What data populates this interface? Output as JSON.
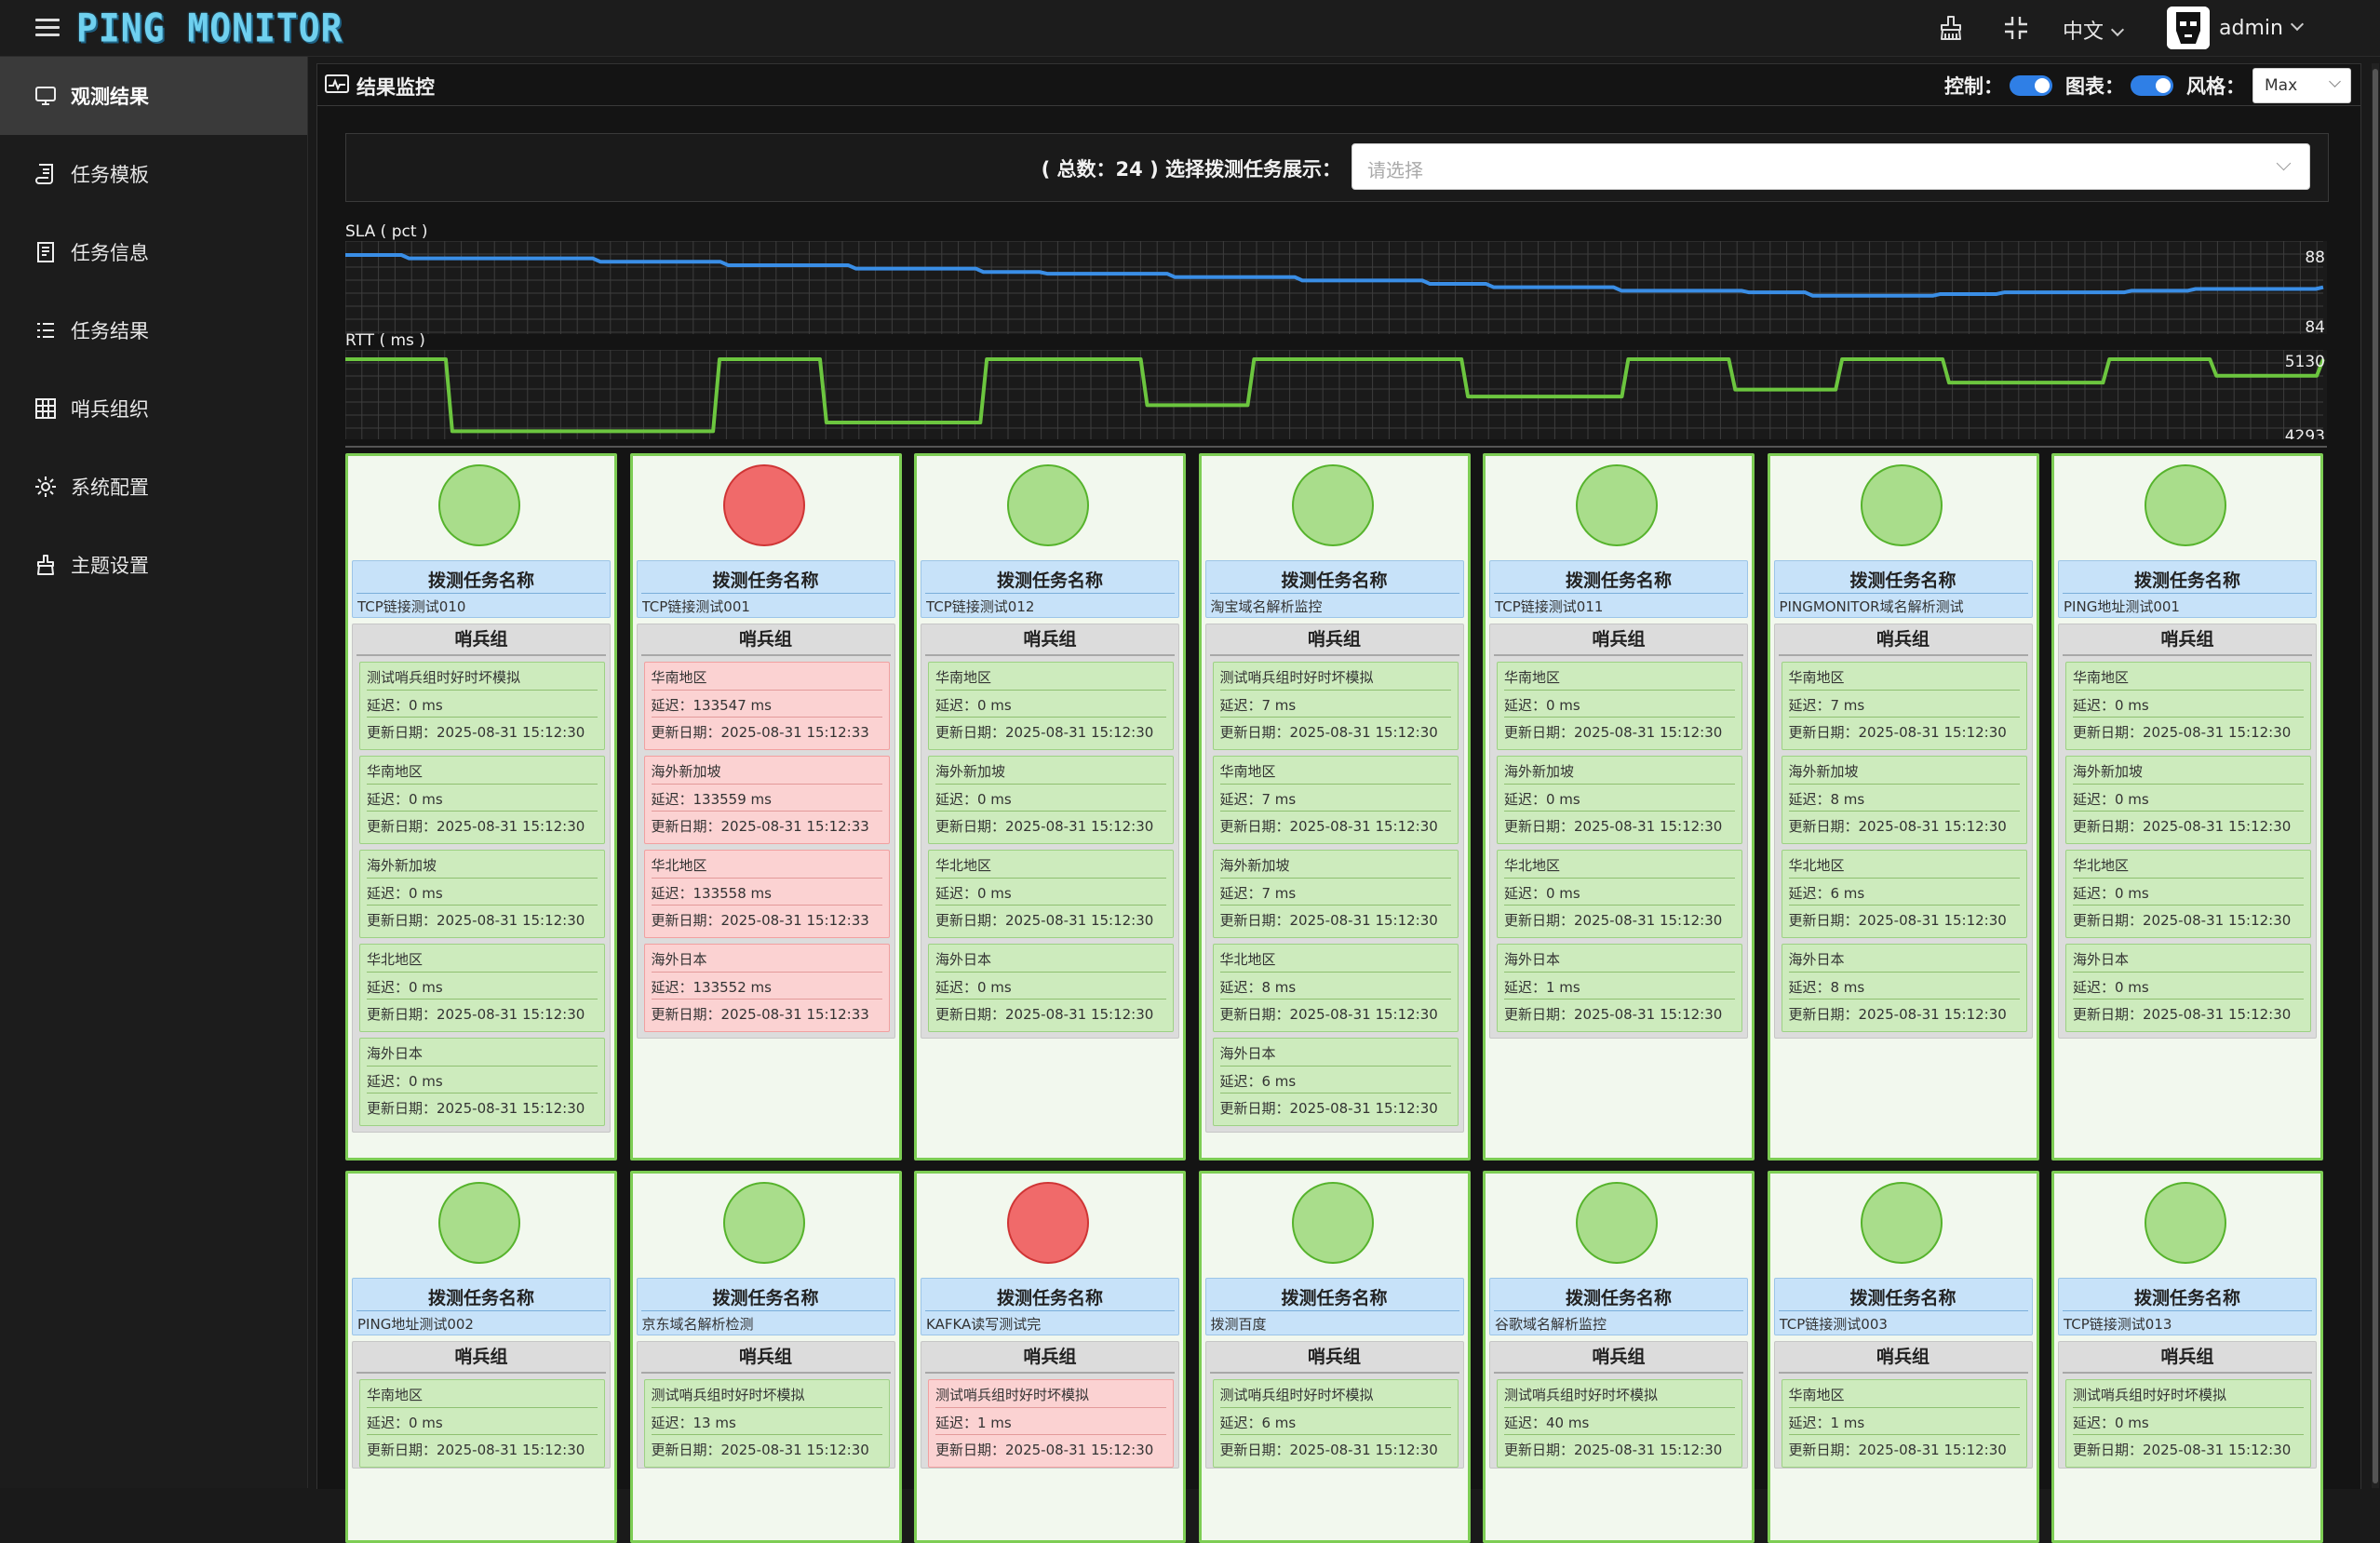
{
  "header": {
    "logo": "PING MONITOR",
    "language": "中文",
    "username": "admin"
  },
  "sidebar": {
    "items": [
      {
        "label": "观测结果",
        "icon": "monitor-icon",
        "active": true
      },
      {
        "label": "任务模板",
        "icon": "scroll-icon",
        "active": false
      },
      {
        "label": "任务信息",
        "icon": "document-icon",
        "active": false
      },
      {
        "label": "任务结果",
        "icon": "list-icon",
        "active": false
      },
      {
        "label": "哨兵组织",
        "icon": "grid-icon",
        "active": false
      },
      {
        "label": "系统配置",
        "icon": "gear-icon",
        "active": false
      },
      {
        "label": "主题设置",
        "icon": "brush-icon",
        "active": false
      }
    ]
  },
  "main": {
    "title": "结果监控",
    "control_label": "控制：",
    "chart_label": "图表：",
    "style_label": "风格：",
    "style_value": "Max",
    "filter_label": "( 总数：24 ) 选择拨测任务展示：",
    "filter_placeholder": "请选择"
  },
  "colors": {
    "ok_circle": "#a9dd8b",
    "bad_circle": "#f06a6a",
    "sla_line": "#3a8ee6",
    "rtt_line": "#6cc63f",
    "toggle_on": "#2f7fe6"
  },
  "chart_data": [
    {
      "type": "line",
      "title": "SLA ( pct )",
      "y_tick_labels": [
        "88",
        "84"
      ],
      "ylim": [
        84,
        88
      ],
      "grid": true,
      "series": [
        {
          "values": [
            88,
            87.8,
            87.8,
            87.8,
            87.6,
            87.6,
            87.4,
            87.4,
            87.2,
            87.2,
            87.0,
            86.9,
            86.9,
            86.7,
            86.7,
            86.5,
            86.5,
            86.3,
            86.1,
            86.1,
            85.9,
            85.9,
            85.8,
            85.6,
            85.6,
            85.7,
            85.8,
            85.8,
            85.9,
            86.0,
            86.0,
            86.1
          ]
        }
      ]
    },
    {
      "type": "line",
      "title": "RTT ( ms )",
      "y_tick_labels": [
        "5130",
        "4293"
      ],
      "ylim": [
        4293,
        5130
      ],
      "grid": true,
      "series": [
        {
          "values": [
            5130,
            5130,
            4300,
            4300,
            4300,
            4300,
            4300,
            5130,
            5130,
            4400,
            4400,
            4400,
            5130,
            5130,
            5130,
            4600,
            4600,
            5130,
            5130,
            5130,
            5130,
            4700,
            4700,
            4700,
            5130,
            5130,
            4780,
            4780,
            5130,
            5130,
            4860,
            4860,
            4860,
            5130,
            5130,
            4940,
            4940,
            5130
          ]
        }
      ]
    }
  ],
  "labels": {
    "task_name": "拨测任务名称",
    "group": "哨兵组",
    "delay_prefix": "延迟：",
    "date_prefix": "更新日期："
  },
  "cards": [
    {
      "name": "TCP链接测试010",
      "status": "ok",
      "items": [
        {
          "region": "测试哨兵组时好时坏模拟",
          "delay": "0 ms",
          "date": "2025-08-31 15:12:30",
          "ok": true
        },
        {
          "region": "华南地区",
          "delay": "0 ms",
          "date": "2025-08-31 15:12:30",
          "ok": true
        },
        {
          "region": "海外新加坡",
          "delay": "0 ms",
          "date": "2025-08-31 15:12:30",
          "ok": true
        },
        {
          "region": "华北地区",
          "delay": "0 ms",
          "date": "2025-08-31 15:12:30",
          "ok": true
        },
        {
          "region": "海外日本",
          "delay": "0 ms",
          "date": "2025-08-31 15:12:30",
          "ok": true
        }
      ]
    },
    {
      "name": "TCP链接测试001",
      "status": "bad",
      "items": [
        {
          "region": "华南地区",
          "delay": "133547 ms",
          "date": "2025-08-31 15:12:33",
          "ok": false
        },
        {
          "region": "海外新加坡",
          "delay": "133559 ms",
          "date": "2025-08-31 15:12:33",
          "ok": false
        },
        {
          "region": "华北地区",
          "delay": "133558 ms",
          "date": "2025-08-31 15:12:33",
          "ok": false
        },
        {
          "region": "海外日本",
          "delay": "133552 ms",
          "date": "2025-08-31 15:12:33",
          "ok": false
        }
      ]
    },
    {
      "name": "TCP链接测试012",
      "status": "ok",
      "items": [
        {
          "region": "华南地区",
          "delay": "0 ms",
          "date": "2025-08-31 15:12:30",
          "ok": true
        },
        {
          "region": "海外新加坡",
          "delay": "0 ms",
          "date": "2025-08-31 15:12:30",
          "ok": true
        },
        {
          "region": "华北地区",
          "delay": "0 ms",
          "date": "2025-08-31 15:12:30",
          "ok": true
        },
        {
          "region": "海外日本",
          "delay": "0 ms",
          "date": "2025-08-31 15:12:30",
          "ok": true
        }
      ]
    },
    {
      "name": "淘宝域名解析监控",
      "status": "ok",
      "items": [
        {
          "region": "测试哨兵组时好时坏模拟",
          "delay": "7 ms",
          "date": "2025-08-31 15:12:30",
          "ok": true
        },
        {
          "region": "华南地区",
          "delay": "7 ms",
          "date": "2025-08-31 15:12:30",
          "ok": true
        },
        {
          "region": "海外新加坡",
          "delay": "7 ms",
          "date": "2025-08-31 15:12:30",
          "ok": true
        },
        {
          "region": "华北地区",
          "delay": "8 ms",
          "date": "2025-08-31 15:12:30",
          "ok": true
        },
        {
          "region": "海外日本",
          "delay": "6 ms",
          "date": "2025-08-31 15:12:30",
          "ok": true
        }
      ]
    },
    {
      "name": "TCP链接测试011",
      "status": "ok",
      "items": [
        {
          "region": "华南地区",
          "delay": "0 ms",
          "date": "2025-08-31 15:12:30",
          "ok": true
        },
        {
          "region": "海外新加坡",
          "delay": "0 ms",
          "date": "2025-08-31 15:12:30",
          "ok": true
        },
        {
          "region": "华北地区",
          "delay": "0 ms",
          "date": "2025-08-31 15:12:30",
          "ok": true
        },
        {
          "region": "海外日本",
          "delay": "1 ms",
          "date": "2025-08-31 15:12:30",
          "ok": true
        }
      ]
    },
    {
      "name": "PINGMONITOR域名解析测试",
      "status": "ok",
      "items": [
        {
          "region": "华南地区",
          "delay": "7 ms",
          "date": "2025-08-31 15:12:30",
          "ok": true
        },
        {
          "region": "海外新加坡",
          "delay": "8 ms",
          "date": "2025-08-31 15:12:30",
          "ok": true
        },
        {
          "region": "华北地区",
          "delay": "6 ms",
          "date": "2025-08-31 15:12:30",
          "ok": true
        },
        {
          "region": "海外日本",
          "delay": "8 ms",
          "date": "2025-08-31 15:12:30",
          "ok": true
        }
      ]
    },
    {
      "name": "PING地址测试001",
      "status": "ok",
      "items": [
        {
          "region": "华南地区",
          "delay": "0 ms",
          "date": "2025-08-31 15:12:30",
          "ok": true
        },
        {
          "region": "海外新加坡",
          "delay": "0 ms",
          "date": "2025-08-31 15:12:30",
          "ok": true
        },
        {
          "region": "华北地区",
          "delay": "0 ms",
          "date": "2025-08-31 15:12:30",
          "ok": true
        },
        {
          "region": "海外日本",
          "delay": "0 ms",
          "date": "2025-08-31 15:12:30",
          "ok": true
        }
      ]
    },
    {
      "name": "PING地址测试002",
      "status": "ok",
      "items": [
        {
          "region": "华南地区",
          "delay": "0 ms",
          "date": "2025-08-31 15:12:30",
          "ok": true
        }
      ]
    },
    {
      "name": "京东域名解析检测",
      "status": "ok",
      "items": [
        {
          "region": "测试哨兵组时好时坏模拟",
          "delay": "13 ms",
          "date": "2025-08-31 15:12:30",
          "ok": true
        }
      ]
    },
    {
      "name": "KAFKA读写测试完",
      "status": "bad",
      "items": [
        {
          "region": "测试哨兵组时好时坏模拟",
          "delay": "1 ms",
          "date": "2025-08-31 15:12:30",
          "ok": false
        }
      ]
    },
    {
      "name": "拨测百度",
      "status": "ok",
      "items": [
        {
          "region": "测试哨兵组时好时坏模拟",
          "delay": "6 ms",
          "date": "2025-08-31 15:12:30",
          "ok": true
        }
      ]
    },
    {
      "name": "谷歌域名解析监控",
      "status": "ok",
      "items": [
        {
          "region": "测试哨兵组时好时坏模拟",
          "delay": "40 ms",
          "date": "2025-08-31 15:12:30",
          "ok": true
        }
      ]
    },
    {
      "name": "TCP链接测试003",
      "status": "ok",
      "items": [
        {
          "region": "华南地区",
          "delay": "1 ms",
          "date": "2025-08-31 15:12:30",
          "ok": true
        }
      ]
    },
    {
      "name": "TCP链接测试013",
      "status": "ok",
      "items": [
        {
          "region": "测试哨兵组时好时坏模拟",
          "delay": "0 ms",
          "date": "2025-08-31 15:12:30",
          "ok": true
        }
      ]
    }
  ]
}
